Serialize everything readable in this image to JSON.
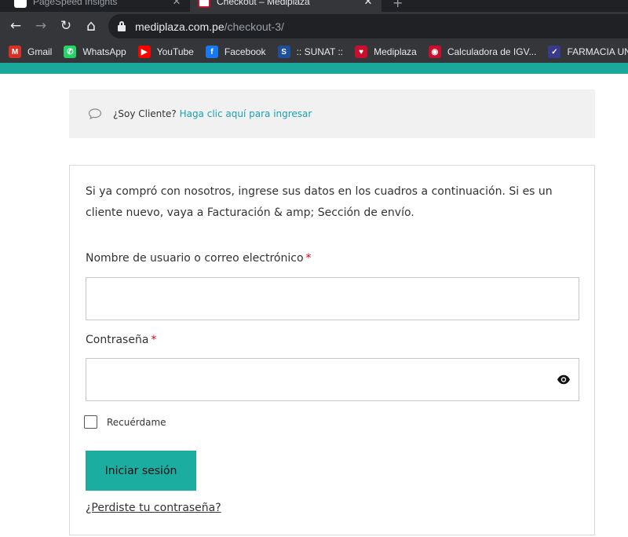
{
  "browser": {
    "tabs": [
      {
        "title": "PageSpeed Insights",
        "close": "✕"
      },
      {
        "title": "Checkout – Mediplaza",
        "close": "✕"
      }
    ],
    "new_tab": "+",
    "nav": {
      "back": "←",
      "forward": "→",
      "reload": "↻",
      "home": "⌂"
    },
    "url_host": "mediplaza.com.pe",
    "url_path": "/checkout-3/",
    "bookmarks": [
      {
        "label": "Gmail",
        "icon": "gmail-icon",
        "color": "#d93025",
        "glyph": "M"
      },
      {
        "label": "WhatsApp",
        "icon": "whatsapp-icon",
        "color": "#25d366",
        "glyph": "✆"
      },
      {
        "label": "YouTube",
        "icon": "youtube-icon",
        "color": "#ff0000",
        "glyph": "▶"
      },
      {
        "label": "Facebook",
        "icon": "facebook-icon",
        "color": "#1877f2",
        "glyph": "f"
      },
      {
        "label": ":: SUNAT ::",
        "icon": "sunat-icon",
        "color": "#1f4e9c",
        "glyph": "S"
      },
      {
        "label": "Mediplaza",
        "icon": "mediplaza-icon",
        "color": "#c8102e",
        "glyph": "♥"
      },
      {
        "label": "Calculadora de IGV...",
        "icon": "calculator-icon",
        "color": "#c8102e",
        "glyph": "◉"
      },
      {
        "label": "FARMACIA UN",
        "icon": "farmacia-icon",
        "color": "#3a3a8c",
        "glyph": "✓"
      }
    ]
  },
  "page": {
    "accent_color": "#1aa89a",
    "notice": {
      "text": "¿Soy Cliente? ",
      "link": "Haga clic aquí para ingresar"
    },
    "login": {
      "intro": "Si ya compró con nosotros, ingrese sus datos en los cuadros a continuación. Si es un cliente nuevo, vaya a Facturación & amp; Sección de envío.",
      "username_label": "Nombre de usuario o correo electrónico",
      "username_value": "",
      "password_label": "Contraseña",
      "password_value": "",
      "required_mark": "*",
      "remember_label": "Recuérdame",
      "remember_checked": false,
      "submit_label": "Iniciar sesión",
      "lost_password": "¿Perdiste tu contraseña?"
    }
  }
}
